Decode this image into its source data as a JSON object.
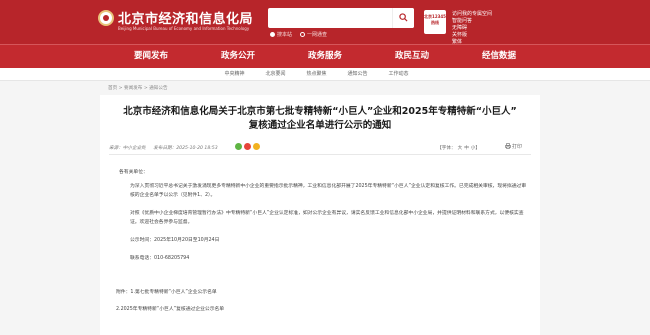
{
  "header": {
    "title": "北京市经济和信息化局",
    "subtitle": "Beijing Municipal Bureau of Economy and Information Technology",
    "search": {
      "placeholder": "",
      "option1": "搜本站",
      "option2": "一网通查"
    },
    "badge": "北京12345热线",
    "links": [
      "访问我的专属空间",
      "智能问答",
      "无障碍",
      "关怀版",
      "繁体"
    ]
  },
  "nav": {
    "items": [
      "要闻发布",
      "政务公开",
      "政务服务",
      "政民互动",
      "经信数据"
    ]
  },
  "subnav": {
    "items": [
      "中央精神",
      "北京要闻",
      "热点聚焦",
      "通知公告",
      "工作动态"
    ]
  },
  "breadcrumb": {
    "home": "首页",
    "sep1": " > ",
    "section": "要闻发布",
    "sep2": " > ",
    "current": "通知公告"
  },
  "article": {
    "title_line1": "北京市经济和信息化局关于北京市第七批专精特新“小巨人”企业和2025年专精特新“小巨人”",
    "title_line2": "复核通过企业名单进行公示的通知",
    "source_label": "来源：",
    "source": "中小企业处",
    "date_label": "发布日期：",
    "date": "2025-10-20 18:53",
    "font_label": "【字体：",
    "font_large": "大",
    "font_medium": "中",
    "font_small": "小】",
    "print_label": "打印",
    "salutation": "各有关单位：",
    "para1": "为深入贯彻习近平总书记关于激发涌现更多专精特新中小企业的重要指示批示精神，工业和信息化部开展了2025年专精特新“小巨人”企业认定和复核工作。已完成相关审核，现将拟通过审核的企业名单予以公示（见附件1、2）。",
    "para2": "对照《优质中小企业梯度培育管理暂行办法》中专精特新“小巨人”企业认定标准，如对公示企业有异议，请实名反馈工业和信息化部中小企业局，并提供证明材料和联系方式，以便核实查证。欢迎社会各界参与监督。",
    "period": "公示时间：2025年10月20日至10月24日",
    "phone": "联系电话：010-68205794",
    "attachment1": "附件：1.第七批专精特新“小巨人”企业公示名单",
    "attachment2": "2.2025年专精特新“小巨人”复核通过企业公示名单"
  },
  "colors": {
    "brand_red": "#b7252a",
    "nav_red": "#c32a2f",
    "share_wechat": "#5fb544",
    "share_weibo": "#e6453a",
    "share_qzone": "#f2b220"
  }
}
